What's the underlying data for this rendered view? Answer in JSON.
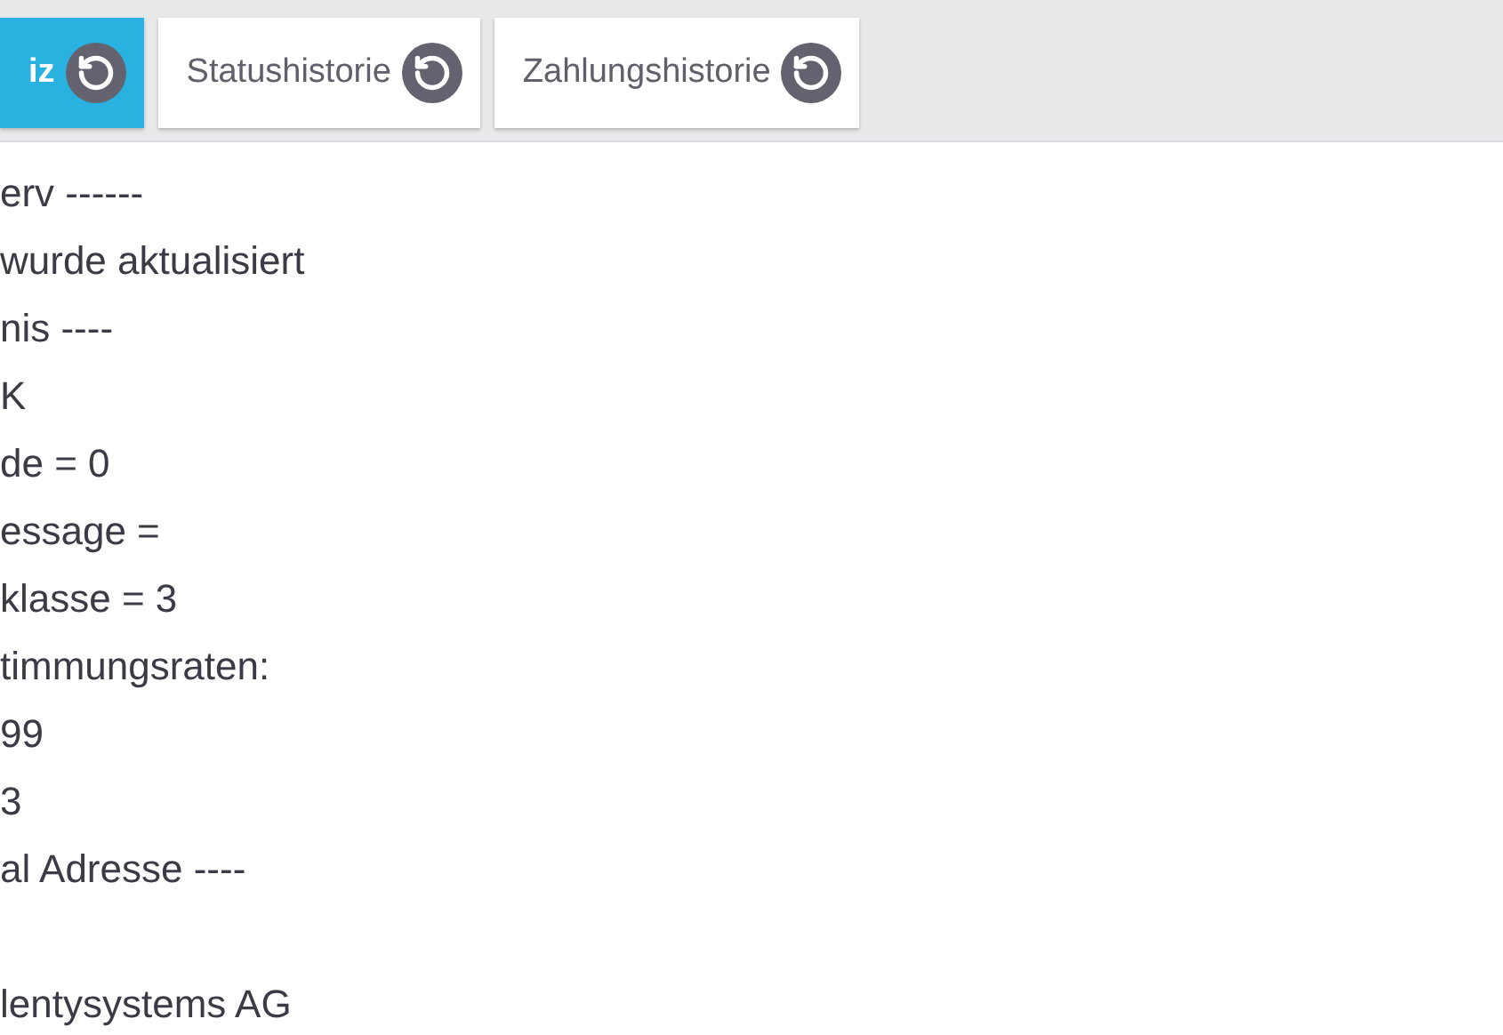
{
  "tabs": [
    {
      "label": "iz",
      "selected": true
    },
    {
      "label": "Statushistorie",
      "selected": false
    },
    {
      "label": "Zahlungshistorie",
      "selected": false
    }
  ],
  "log_lines": [
    {
      "kind": "text",
      "text": "erv ------"
    },
    {
      "kind": "text",
      "text": "wurde aktualisiert"
    },
    {
      "kind": "text",
      "text": "nis ----"
    },
    {
      "kind": "text",
      "text": "K"
    },
    {
      "kind": "text",
      "text": "de = 0"
    },
    {
      "kind": "text",
      "text": "essage ="
    },
    {
      "kind": "text",
      "text": "klasse = 3"
    },
    {
      "kind": "text",
      "text": "timmungsraten:"
    },
    {
      "kind": "text",
      "text": "99"
    },
    {
      "kind": "text",
      "text": "3"
    },
    {
      "kind": "text",
      "text": "al Adresse ----"
    },
    {
      "kind": "blank"
    },
    {
      "kind": "text",
      "text": "lentysystems AG"
    }
  ]
}
